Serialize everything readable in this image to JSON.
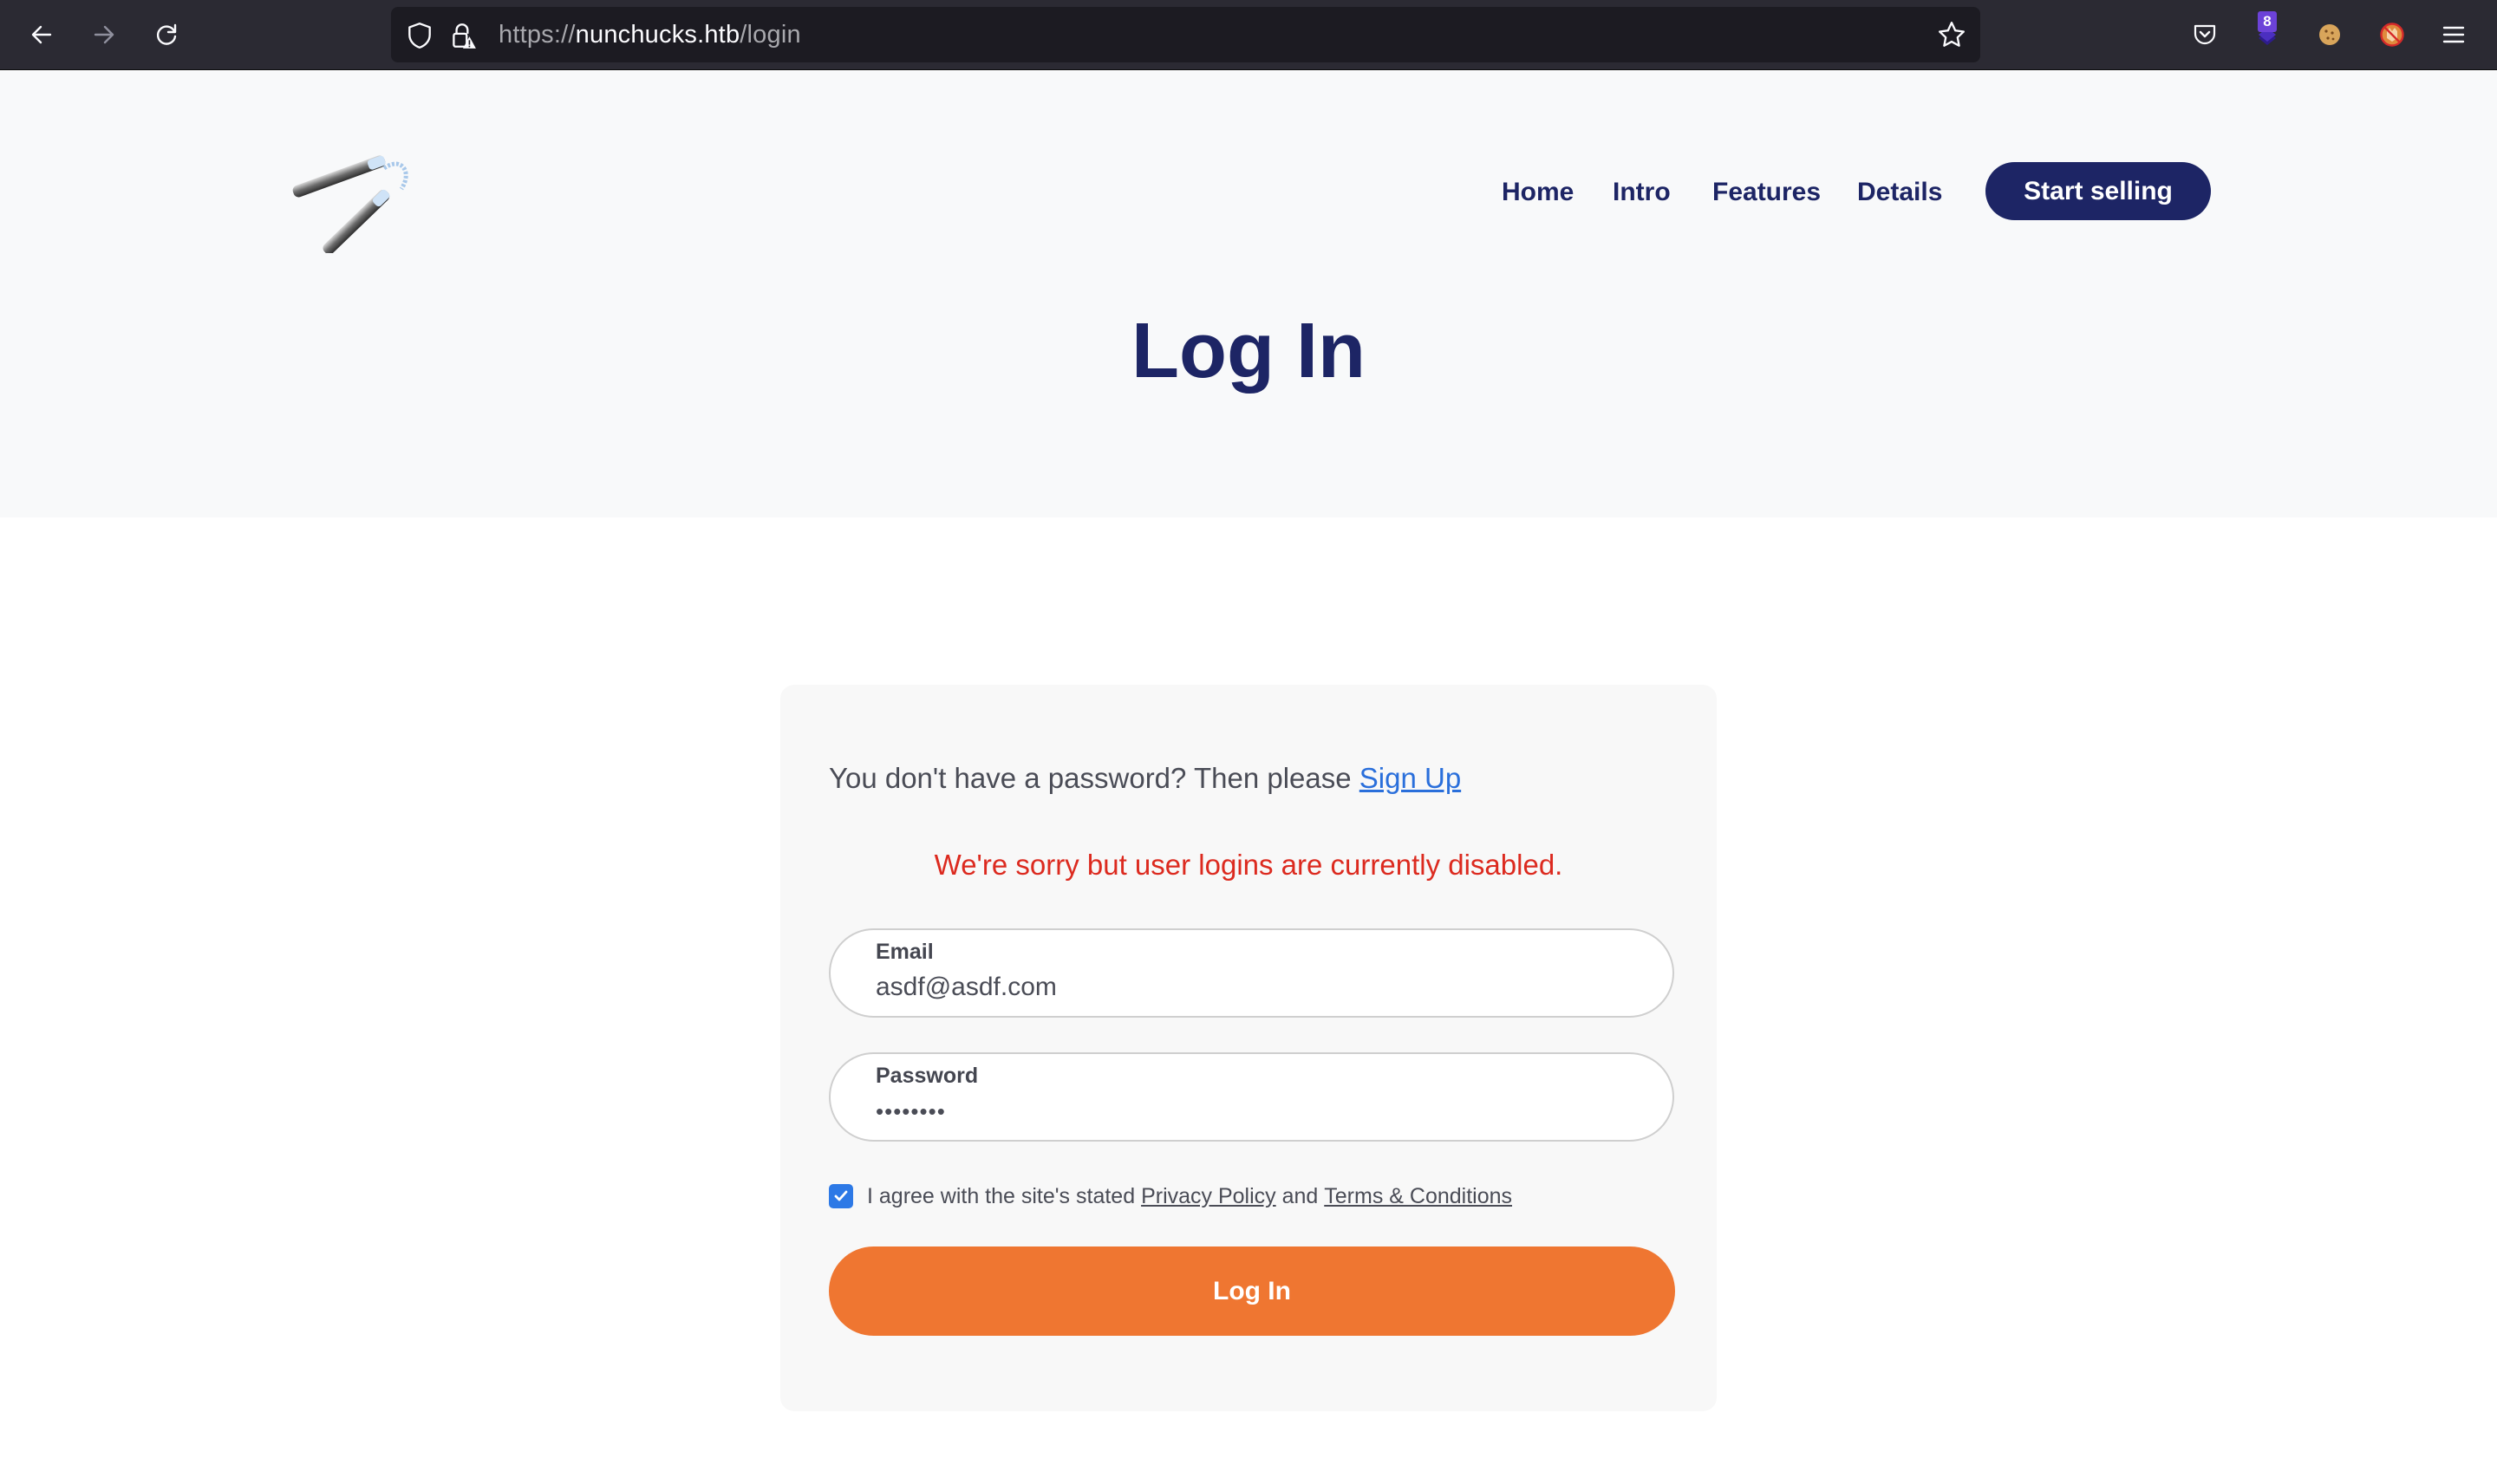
{
  "browser": {
    "url_scheme": "https://",
    "url_host": "nunchucks.htb",
    "url_path": "/login",
    "extension_badge_count": "8",
    "icons": [
      "back-arrow-icon",
      "forward-arrow-icon",
      "reload-icon",
      "shield-icon",
      "insecure-lock-icon",
      "bookmark-star-icon",
      "pocket-icon",
      "extension-stack-icon",
      "cookie-icon",
      "blocked-fox-icon",
      "hamburger-menu-icon"
    ]
  },
  "header": {
    "logo_alt": "nunchucks logo",
    "nav": [
      {
        "label": "Home"
      },
      {
        "label": "Intro"
      },
      {
        "label": "Features"
      },
      {
        "label": "Details"
      }
    ],
    "cta_label": "Start selling",
    "page_title": "Log In"
  },
  "form": {
    "signup_prompt": "You don't have a password? Then please ",
    "signup_link": "Sign Up",
    "error_message": "We're sorry but user logins are currently disabled.",
    "email": {
      "label": "Email",
      "value": "asdf@asdf.com"
    },
    "password": {
      "label": "Password",
      "value": "••••••••"
    },
    "agree": {
      "checked": true,
      "prefix": "I agree with the site's stated ",
      "privacy_link": "Privacy Policy",
      "middle": " and ",
      "terms_link": "Terms & Conditions"
    },
    "submit_label": "Log In"
  },
  "colors": {
    "brand_navy": "#1d2565",
    "accent_orange": "#ef7631",
    "error_red": "#dc2a1f",
    "link_blue": "#2a6fdb",
    "checkbox_blue": "#2d79e6"
  }
}
